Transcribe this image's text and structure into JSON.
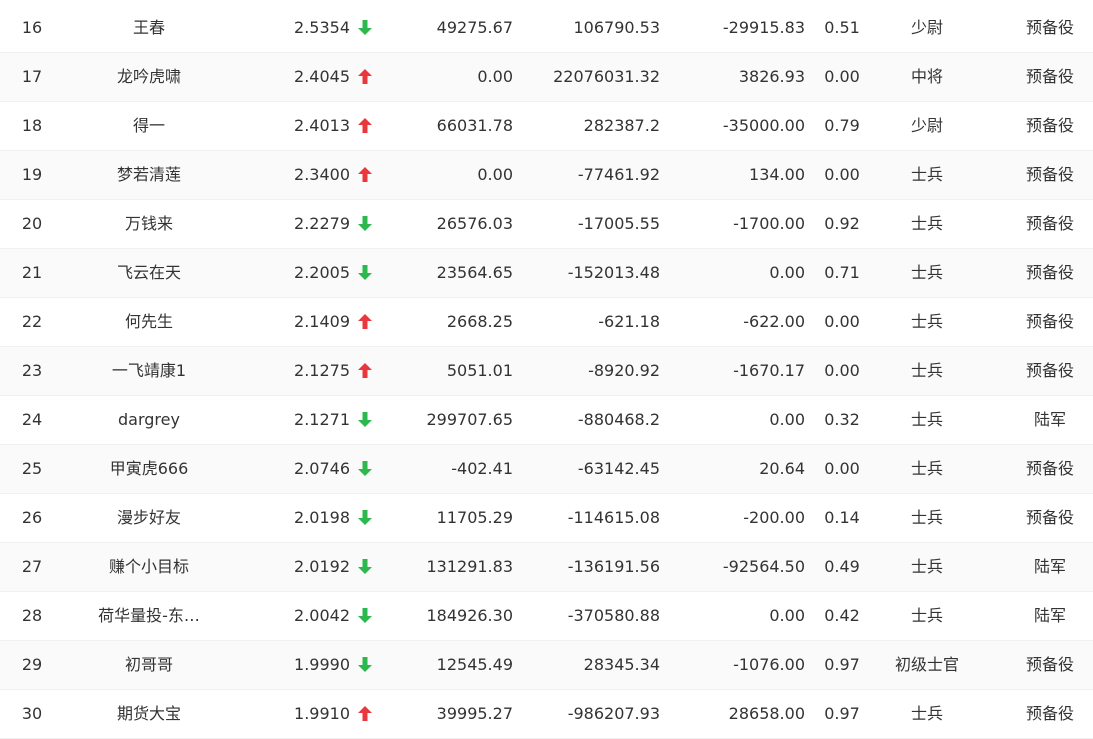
{
  "colors": {
    "up": "#e8383d",
    "down": "#2db84d",
    "text": "#333333"
  },
  "rows": [
    {
      "rank": "16",
      "name": "王春",
      "score": "2.5354",
      "trend": "down",
      "v1": "49275.67",
      "v2": "106790.53",
      "v3": "-29915.83",
      "ratio": "0.51",
      "title": "少尉",
      "status": "预备役"
    },
    {
      "rank": "17",
      "name": "龙吟虎啸",
      "score": "2.4045",
      "trend": "up",
      "v1": "0.00",
      "v2": "22076031.32",
      "v3": "3826.93",
      "ratio": "0.00",
      "title": "中将",
      "status": "预备役"
    },
    {
      "rank": "18",
      "name": "得一",
      "score": "2.4013",
      "trend": "up",
      "v1": "66031.78",
      "v2": "282387.2",
      "v3": "-35000.00",
      "ratio": "0.79",
      "title": "少尉",
      "status": "预备役"
    },
    {
      "rank": "19",
      "name": "梦若清莲",
      "score": "2.3400",
      "trend": "up",
      "v1": "0.00",
      "v2": "-77461.92",
      "v3": "134.00",
      "ratio": "0.00",
      "title": "士兵",
      "status": "预备役"
    },
    {
      "rank": "20",
      "name": "万钱来",
      "score": "2.2279",
      "trend": "down",
      "v1": "26576.03",
      "v2": "-17005.55",
      "v3": "-1700.00",
      "ratio": "0.92",
      "title": "士兵",
      "status": "预备役"
    },
    {
      "rank": "21",
      "name": "飞云在天",
      "score": "2.2005",
      "trend": "down",
      "v1": "23564.65",
      "v2": "-152013.48",
      "v3": "0.00",
      "ratio": "0.71",
      "title": "士兵",
      "status": "预备役"
    },
    {
      "rank": "22",
      "name": "何先生",
      "score": "2.1409",
      "trend": "up",
      "v1": "2668.25",
      "v2": "-621.18",
      "v3": "-622.00",
      "ratio": "0.00",
      "title": "士兵",
      "status": "预备役"
    },
    {
      "rank": "23",
      "name": "一飞靖康1",
      "score": "2.1275",
      "trend": "up",
      "v1": "5051.01",
      "v2": "-8920.92",
      "v3": "-1670.17",
      "ratio": "0.00",
      "title": "士兵",
      "status": "预备役"
    },
    {
      "rank": "24",
      "name": "dargrey",
      "score": "2.1271",
      "trend": "down",
      "v1": "299707.65",
      "v2": "-880468.2",
      "v3": "0.00",
      "ratio": "0.32",
      "title": "士兵",
      "status": "陆军"
    },
    {
      "rank": "25",
      "name": "甲寅虎666",
      "score": "2.0746",
      "trend": "down",
      "v1": "-402.41",
      "v2": "-63142.45",
      "v3": "20.64",
      "ratio": "0.00",
      "title": "士兵",
      "status": "预备役"
    },
    {
      "rank": "26",
      "name": "漫步好友",
      "score": "2.0198",
      "trend": "down",
      "v1": "11705.29",
      "v2": "-114615.08",
      "v3": "-200.00",
      "ratio": "0.14",
      "title": "士兵",
      "status": "预备役"
    },
    {
      "rank": "27",
      "name": "赚个小目标",
      "score": "2.0192",
      "trend": "down",
      "v1": "131291.83",
      "v2": "-136191.56",
      "v3": "-92564.50",
      "ratio": "0.49",
      "title": "士兵",
      "status": "陆军"
    },
    {
      "rank": "28",
      "name": "荷华量投-东…",
      "score": "2.0042",
      "trend": "down",
      "v1": "184926.30",
      "v2": "-370580.88",
      "v3": "0.00",
      "ratio": "0.42",
      "title": "士兵",
      "status": "陆军"
    },
    {
      "rank": "29",
      "name": "初哥哥",
      "score": "1.9990",
      "trend": "down",
      "v1": "12545.49",
      "v2": "28345.34",
      "v3": "-1076.00",
      "ratio": "0.97",
      "title": "初级士官",
      "status": "预备役"
    },
    {
      "rank": "30",
      "name": "期货大宝",
      "score": "1.9910",
      "trend": "up",
      "v1": "39995.27",
      "v2": "-986207.93",
      "v3": "28658.00",
      "ratio": "0.97",
      "title": "士兵",
      "status": "预备役"
    }
  ]
}
